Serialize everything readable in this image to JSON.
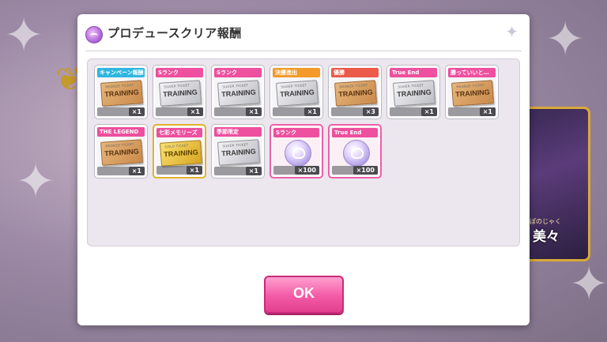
{
  "dialog": {
    "title": "プロデュースクリア報酬",
    "ok_label": "OK"
  },
  "background": {
    "card_name": "美々",
    "card_sub": "ぽのじゃく"
  },
  "rewards": [
    {
      "label": "キャンペーン報酬",
      "label_color": "#2fb6e0",
      "item": "TRAINING",
      "ticket_header": "BRONZE TICKET",
      "type": "bronze",
      "qty": "×1"
    },
    {
      "label": "Sランク",
      "label_color": "#ee4f9e",
      "item": "TRAINING",
      "ticket_header": "SILVER TICKET",
      "type": "silver",
      "qty": "×1"
    },
    {
      "label": "Sランク",
      "label_color": "#ee4f9e",
      "item": "TRAINING",
      "ticket_header": "SILVER TICKET",
      "type": "silver",
      "qty": "×1"
    },
    {
      "label": "決勝進出",
      "label_color": "#f39a2a",
      "item": "TRAINING",
      "ticket_header": "SILVER TICKET",
      "type": "silver",
      "qty": "×1"
    },
    {
      "label": "優勝",
      "label_color": "#ec5a4a",
      "item": "TRAINING",
      "ticket_header": "BRONZE TICKET",
      "type": "bronze",
      "qty": "×3"
    },
    {
      "label": "True End",
      "label_color": "#ee4f9e",
      "item": "TRAINING",
      "ticket_header": "SILVER TICKET",
      "type": "silver",
      "qty": "×1"
    },
    {
      "label": "勝っていいと…",
      "label_color": "#ee4f9e",
      "item": "TRAINING",
      "ticket_header": "BRONZE TICKET",
      "type": "bronze",
      "qty": "×1"
    },
    {
      "label": "THE LEGEND",
      "label_color": "#ee4f9e",
      "item": "TRAINING",
      "ticket_header": "BRONZE TICKET",
      "type": "bronze",
      "qty": "×1"
    },
    {
      "label": "七彩メモリーズ",
      "label_color": "#ee4f9e",
      "item": "TRAINING",
      "ticket_header": "GOLD TICKET",
      "type": "gold",
      "qty": "×1",
      "frame": "gold"
    },
    {
      "label": "季節限定",
      "label_color": "#ee4f9e",
      "item": "TRAINING",
      "ticket_header": "SILVER TICKET",
      "type": "silver",
      "qty": "×1"
    },
    {
      "label": "Sランク",
      "label_color": "#ee4f9e",
      "item": "crystal",
      "type": "crystal",
      "qty": "×100",
      "frame": "pink"
    },
    {
      "label": "True End",
      "label_color": "#ee4f9e",
      "item": "crystal",
      "type": "crystal",
      "qty": "×100",
      "frame": "pink"
    }
  ]
}
